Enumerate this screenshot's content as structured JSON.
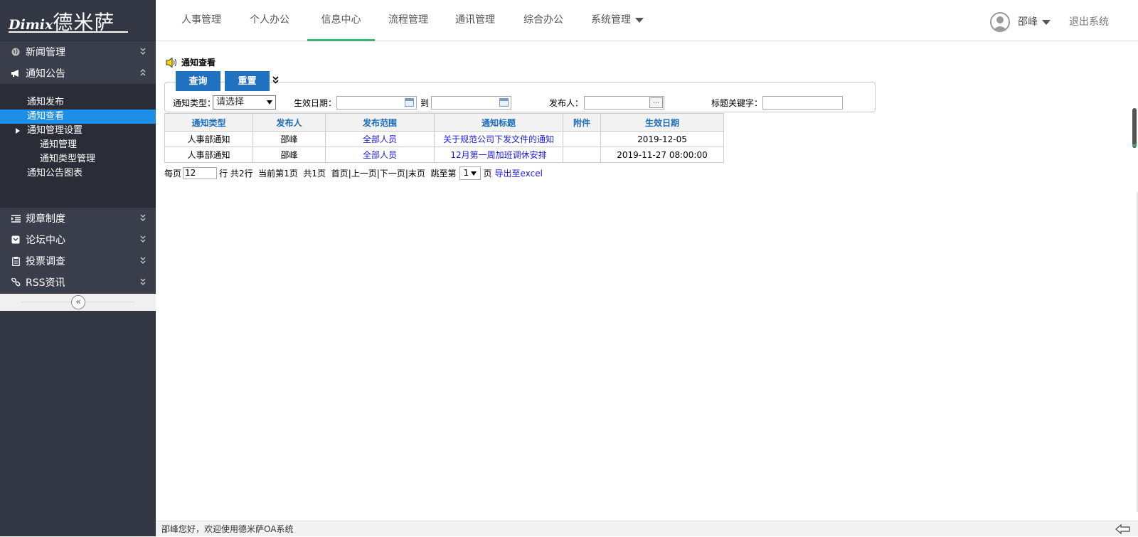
{
  "logo": {
    "en": "Dimix",
    "cn": "德米萨"
  },
  "sidebar": {
    "sections_top": [
      {
        "label": "新闻管理",
        "icon": "globe-icon",
        "expanded": false
      },
      {
        "label": "通知公告",
        "icon": "megaphone-icon",
        "expanded": true
      }
    ],
    "submenu": [
      {
        "label": "通知发布"
      },
      {
        "label": "通知查看",
        "active": true
      },
      {
        "label": "通知管理设置"
      },
      {
        "label": "通知管理"
      },
      {
        "label": "通知类型管理"
      },
      {
        "label": "通知公告图表"
      }
    ],
    "sections_bottom": [
      {
        "label": "规章制度",
        "icon": "list-indent-icon"
      },
      {
        "label": "论坛中心",
        "icon": "forum-icon"
      },
      {
        "label": "投票调查",
        "icon": "clipboard-icon"
      },
      {
        "label": "RSS资讯",
        "icon": "link-icon"
      }
    ],
    "collapse_glyph": "«"
  },
  "topnav": {
    "items": [
      {
        "label": "人事管理"
      },
      {
        "label": "个人办公"
      },
      {
        "label": "信息中心",
        "active": true
      },
      {
        "label": "流程管理"
      },
      {
        "label": "通讯管理"
      },
      {
        "label": "综合办公"
      },
      {
        "label": "系统管理"
      }
    ],
    "user": "邵峰",
    "logout": "退出系统",
    "active_color": "#3cb371"
  },
  "page": {
    "title": "通知查看",
    "query_button": "查询",
    "reset_button": "重置",
    "expand_glyph": "»",
    "filters": {
      "type_label": "通知类型：",
      "type_value": "请选择",
      "date_label": "生效日期：",
      "date_to": "到",
      "publisher_label": "发布人：",
      "keyword_label": "标题关键字："
    }
  },
  "table": {
    "columns": [
      "通知类型",
      "发布人",
      "发布范围",
      "通知标题",
      "附件",
      "生效日期"
    ],
    "rows": [
      [
        "人事部通知",
        "邵峰",
        "全部人员",
        "关于规范公司下发文件的通知",
        "",
        "2019-12-05"
      ],
      [
        "人事部通知",
        "邵峰",
        "全部人员",
        "12月第一周加班调休安排",
        "",
        "2019-11-27 08:00:00"
      ]
    ]
  },
  "pager": {
    "per_page_label": "每页",
    "per_page_value": "12",
    "rows_text": "行 共2行",
    "current_text": "当前第1页",
    "total_text": "共1页",
    "first": "首页",
    "prev": "上一页",
    "next": "下一页",
    "last": "末页",
    "jump_label": "跳至第",
    "jump_value": "1",
    "page_suffix": "页",
    "export": "导出至excel"
  },
  "footer": {
    "text": "邵峰您好，欢迎使用德米萨OA系统"
  },
  "colors": {
    "sidebar_bg": "#333744",
    "active_item": "#1e8fe8",
    "button": "#2171c1",
    "header_text": "#1f6dbd",
    "link": "#1a1ae6"
  }
}
